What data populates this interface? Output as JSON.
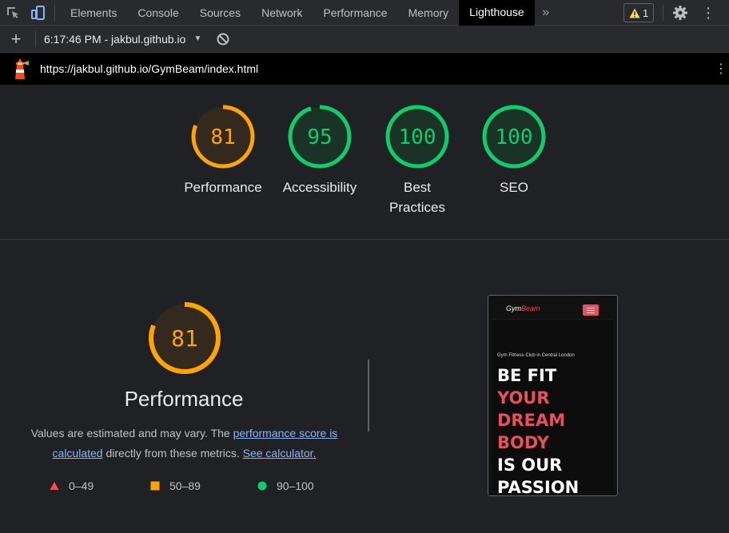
{
  "devtools": {
    "tabs": [
      "Elements",
      "Console",
      "Sources",
      "Network",
      "Performance",
      "Memory",
      "Lighthouse"
    ],
    "active_tab": "Lighthouse",
    "warning_count": "1"
  },
  "toolbar": {
    "report_label": "6:17:46 PM - jakbul.github.io"
  },
  "urlbar": {
    "url": "https://jakbul.github.io/GymBeam/index.html"
  },
  "scores": [
    {
      "label": "Performance",
      "value": 81,
      "color": "#ffa400"
    },
    {
      "label": "Accessibility",
      "value": 95,
      "color": "#0cce6b"
    },
    {
      "label": "Best\nPractices",
      "value": 100,
      "color": "#0cce6b"
    },
    {
      "label": "SEO",
      "value": 100,
      "color": "#0cce6b"
    }
  ],
  "performance": {
    "score": 81,
    "title": "Performance",
    "desc_prefix": "Values are estimated and may vary. The",
    "link_score": "performance score is calculated",
    "desc_middle": "directly from these metrics.",
    "link_calc": "See calculator."
  },
  "legend": [
    {
      "range": "0–49",
      "color": "#ff4e42",
      "shape": "triangle"
    },
    {
      "range": "50–89",
      "color": "#ffa400",
      "shape": "square"
    },
    {
      "range": "90–100",
      "color": "#0cce6b",
      "shape": "circle"
    }
  ],
  "thumbnail": {
    "logo_a": "Gym",
    "logo_b": "Beam",
    "subtitle": "Gym Fitness Club in Central London",
    "hero_lines": [
      {
        "text": "BE FIT",
        "color": "#ffffff"
      },
      {
        "text": "YOUR",
        "color": "#e8505b"
      },
      {
        "text": "DREAM",
        "color": "#e8505b"
      },
      {
        "text": "BODY",
        "color": "#e8505b"
      },
      {
        "text": "IS OUR",
        "color": "#ffffff"
      },
      {
        "text": "PASSION",
        "color": "#ffffff"
      }
    ]
  }
}
